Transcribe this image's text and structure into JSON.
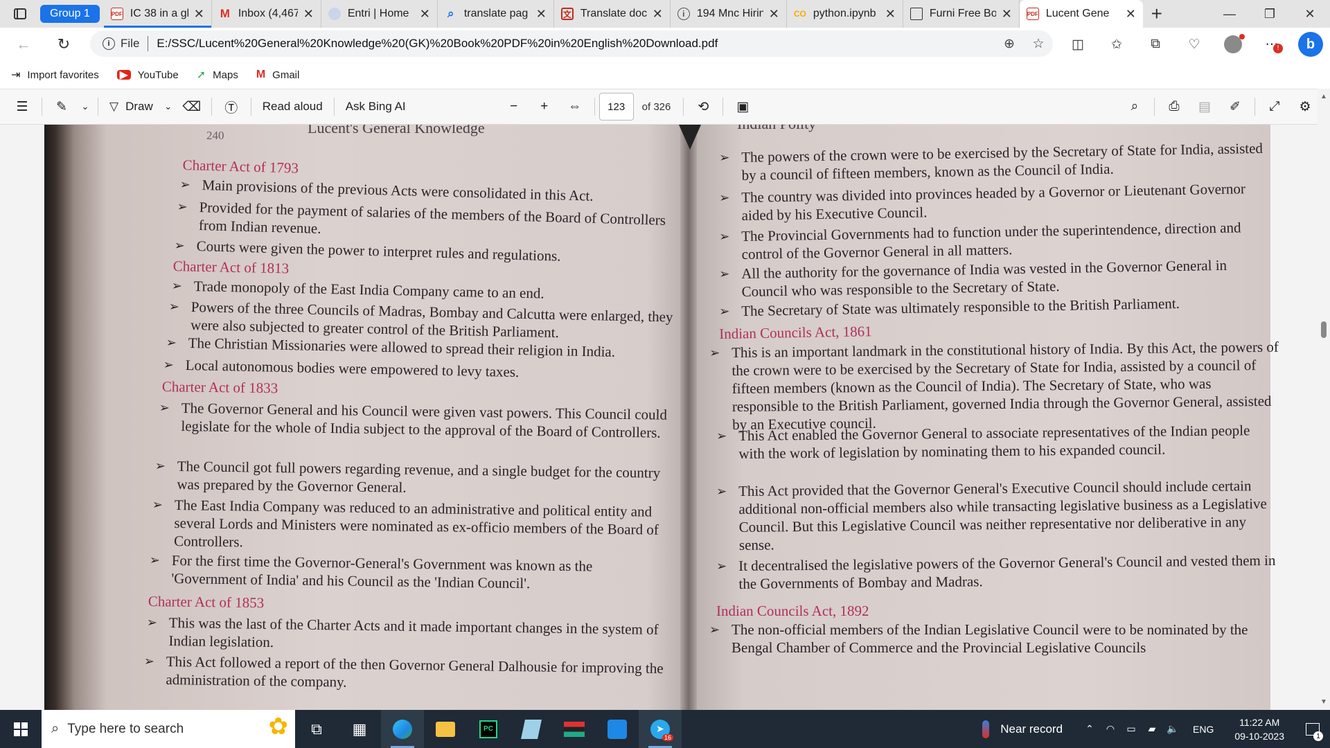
{
  "browser": {
    "tab_group_label": "Group 1",
    "tabs": [
      {
        "title": "IC 38 in a gla",
        "icon": "pdf-icon"
      },
      {
        "title": "Inbox (4,467)",
        "icon": "gmail-icon"
      },
      {
        "title": "Entri | Home",
        "icon": "entri-icon"
      },
      {
        "title": "translate pag",
        "icon": "search-icon"
      },
      {
        "title": "Translate doc",
        "icon": "translate-icon"
      },
      {
        "title": "194 Mnc Hirin",
        "icon": "info-icon"
      },
      {
        "title": "python.ipynb",
        "icon": "colab-icon"
      },
      {
        "title": "Furni Free Bo",
        "icon": "document-icon"
      },
      {
        "title": "Lucent Gene",
        "icon": "pdf-icon",
        "active": true
      }
    ],
    "address": {
      "scheme_label": "File",
      "url": "E:/SSC/Lucent%20General%20Knowledge%20(GK)%20Book%20PDF%20in%20English%20Download.pdf"
    },
    "favorites": [
      {
        "label": "Import favorites",
        "icon": "import-icon"
      },
      {
        "label": "YouTube",
        "icon": "youtube-icon"
      },
      {
        "label": "Maps",
        "icon": "maps-icon"
      },
      {
        "label": "Gmail",
        "icon": "gmail-icon"
      }
    ],
    "accent_color": "#1a73e8"
  },
  "pdf_toolbar": {
    "draw_label": "Draw",
    "read_aloud_label": "Read aloud",
    "ask_bing_label": "Ask Bing AI",
    "current_page": "123",
    "total_pages": "of 326"
  },
  "document": {
    "left": {
      "page_number": "240",
      "running_head": "Lucent's General Knowledge",
      "sections": [
        {
          "heading": "Charter Act of 1793",
          "items": [
            "Main provisions of the previous Acts were consolidated in this Act.",
            "Provided for the payment of salaries of the members of the Board of Controllers from Indian revenue.",
            "Courts were given the power to interpret rules and regulations."
          ]
        },
        {
          "heading": "Charter Act of 1813",
          "items": [
            "Trade monopoly of the East India Company came to an end.",
            "Powers of the three Councils of Madras, Bombay and Calcutta were enlarged, they were also subjected to greater control of the British Parliament.",
            "The Christian Missionaries were allowed to spread their religion in India.",
            "Local autonomous bodies were empowered to levy taxes."
          ]
        },
        {
          "heading": "Charter Act of 1833",
          "items": [
            "The Governor General and his Council were given vast powers. This Council could legislate for the whole of India subject to the approval of the Board of Controllers.",
            "The Council got full powers regarding revenue, and a single budget for the country was prepared by the Governor General.",
            "The East India Company was reduced to an administrative and political entity and several Lords and Ministers were nominated as ex-officio members of the Board of Controllers.",
            "For the first time the Governor-General's Government was known as the 'Government of India' and his Council as the 'Indian Council'."
          ]
        },
        {
          "heading": "Charter Act of 1853",
          "items": [
            "This was the last of the Charter Acts and it made important changes in the system of Indian legislation.",
            "This Act followed a report of the then Governor General Dalhousie for improving the administration of the company."
          ]
        }
      ]
    },
    "right": {
      "running_head": "Indian Polity",
      "top_items": [
        "The powers of the crown were to be exercised by the Secretary of State for India, assisted by a council of fifteen members, known as the Council of India.",
        "The country was divided into provinces headed by a Governor or Lieutenant Governor aided by his Executive Council.",
        "The Provincial Governments had to function under the superintendence, direction and control of the Governor General in all matters.",
        "All the authority for the governance of India was vested in the Governor General in Council who was responsible to the Secretary of State.",
        "The Secretary of State was ultimately responsible to the British Parliament."
      ],
      "sections": [
        {
          "heading": "Indian Councils Act, 1861",
          "items": [
            "This is an important landmark in the constitutional history of India. By this Act, the powers of the crown were to be exercised by the Secretary of State for India, assisted by a council of fifteen members (known as the Council of India). The Secretary of State, who was responsible to the British Parliament, governed India through the Governor General, assisted by an Executive council.",
            "This Act enabled the Governor General to associate representatives of the Indian people with the work of legislation by nominating them to his expanded council.",
            "This Act provided that the Governor General's Executive Council should include certain additional non-official members also while transacting legislative business as a Legislative Council. But this Legislative Council was neither representative nor deliberative in any sense.",
            "It decentralised the legislative powers of the Governor General's Council and vested them in the Governments of Bombay and Madras."
          ]
        },
        {
          "heading": "Indian Councils Act, 1892",
          "items": [
            "The non-official members of the Indian Legislative Council were to be nominated by the Bengal Chamber of Commerce and the Provincial Legislative Councils"
          ]
        }
      ]
    },
    "heading_color": "#b0305a"
  },
  "taskbar": {
    "search_placeholder": "Type here to search",
    "weather_text": "Near record",
    "language": "ENG",
    "time": "11:22 AM",
    "date": "09-10-2023",
    "telegram_badge": "16",
    "notification_count": "1"
  }
}
